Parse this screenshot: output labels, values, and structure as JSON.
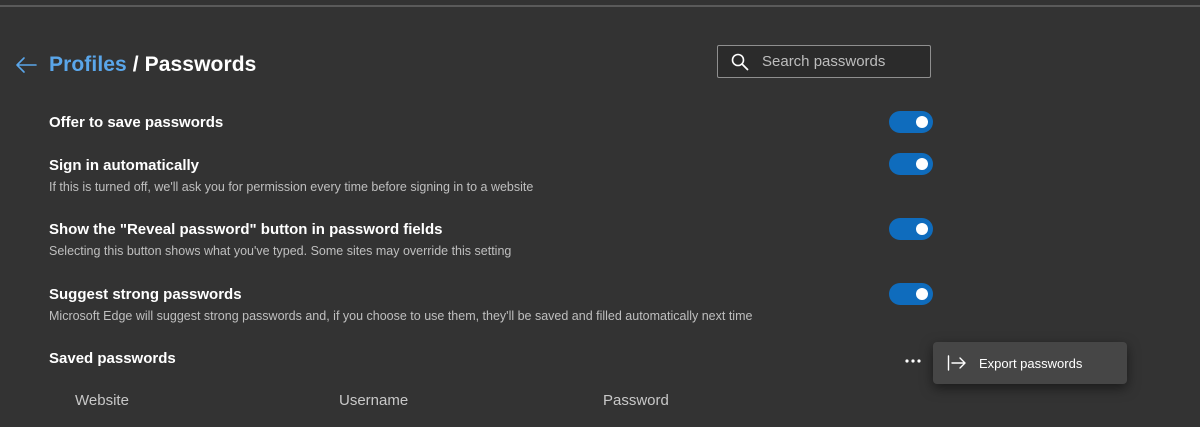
{
  "header": {
    "breadcrumb_parent": "Profiles",
    "breadcrumb_separator": " / ",
    "breadcrumb_current": "Passwords"
  },
  "search": {
    "placeholder": "Search passwords",
    "value": ""
  },
  "settings": [
    {
      "title": "Offer to save passwords",
      "description": "",
      "enabled": true
    },
    {
      "title": "Sign in automatically",
      "description": "If this is turned off, we'll ask you for permission every time before signing in to a website",
      "enabled": true
    },
    {
      "title": "Show the \"Reveal password\" button in password fields",
      "description": "Selecting this button shows what you've typed. Some sites may override this setting",
      "enabled": true
    },
    {
      "title": "Suggest strong passwords",
      "description": "Microsoft Edge will suggest strong passwords and, if you choose to use them, they'll be saved and filled automatically next time",
      "enabled": true
    }
  ],
  "saved": {
    "title": "Saved passwords",
    "more_label": "...",
    "menu_items": [
      {
        "label": "Export passwords",
        "icon": "export-icon"
      }
    ],
    "columns": [
      "Website",
      "Username",
      "Password"
    ]
  },
  "colors": {
    "background": "#333333",
    "accent": "#0f6cbd",
    "link": "#5aa6ea",
    "menu_background": "#464646"
  },
  "icons": {
    "back": "arrow-left-icon",
    "search": "search-icon",
    "more": "more-horizontal-icon",
    "export": "export-icon"
  }
}
